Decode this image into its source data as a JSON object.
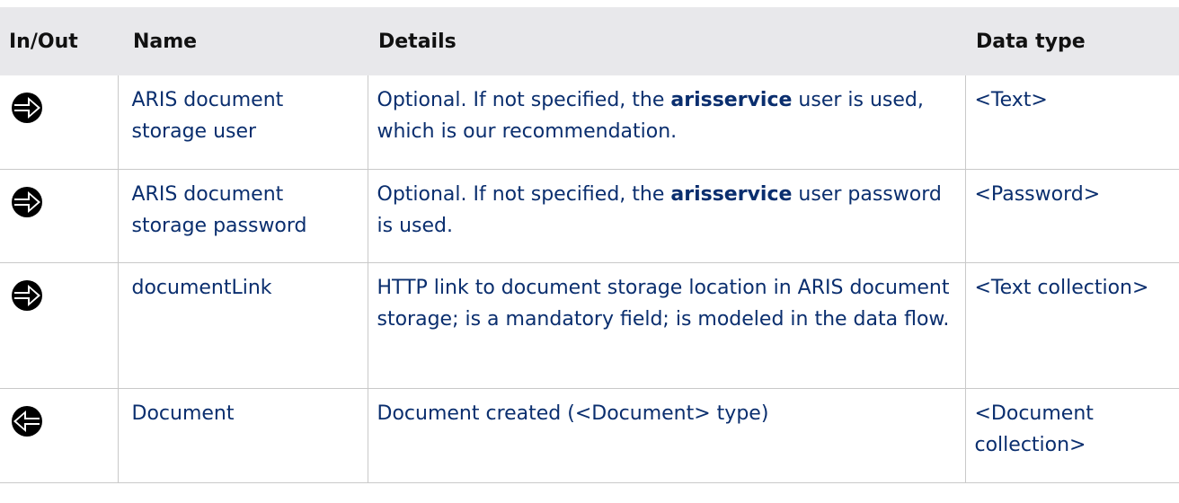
{
  "table": {
    "headers": [
      "In/Out",
      "Name",
      "Details",
      "Data type"
    ],
    "rows": [
      {
        "direction": "in-arrow-icon",
        "name": "ARIS document storage user",
        "details": {
          "pre": "Optional. If not specified, the ",
          "bold": "arisservice",
          "post": " user is used, which is our recommendation."
        },
        "data_type": "<Text>"
      },
      {
        "direction": "in-arrow-icon",
        "name": "ARIS document storage password",
        "details": {
          "pre": "Optional. If not specified, the ",
          "bold": "arisservice",
          "post": " user password is used."
        },
        "data_type": "<Password>"
      },
      {
        "direction": "in-arrow-icon",
        "name": "documentLink",
        "details": {
          "pre": "HTTP link to document storage location in ARIS document storage; is a mandatory field; is modeled in the data flow.",
          "bold": "",
          "post": ""
        },
        "data_type": "<Text collection>"
      },
      {
        "direction": "out-arrow-icon",
        "name": "Document",
        "details": {
          "pre": "Document created (<Document> type)",
          "bold": "",
          "post": ""
        },
        "data_type": "<Document collection>"
      }
    ]
  },
  "colors": {
    "header_bg": "#e8e8eb",
    "text": "#0a2e6e",
    "border": "#c9c9c9"
  }
}
